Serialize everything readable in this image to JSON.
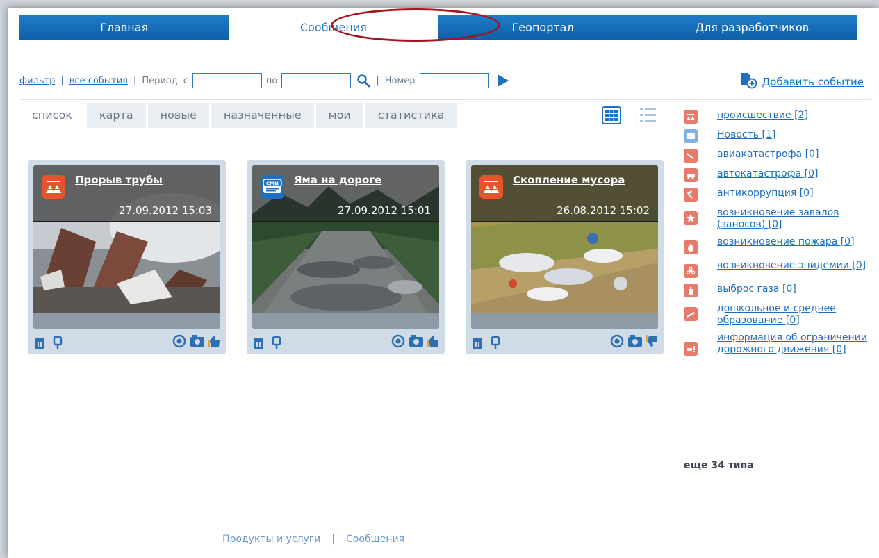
{
  "nav": {
    "items": [
      "Главная",
      "Сообщения",
      "Геопортал",
      "Для разработчиков"
    ],
    "active": 1
  },
  "filter": {
    "filter_link": "фильтр",
    "all_events_link": "все события",
    "period_label": "Период",
    "from_label": "с",
    "to_label": "по",
    "number_label": "Номер",
    "from_value": "",
    "to_value": "",
    "number_value": ""
  },
  "add_event": {
    "label": "Добавить событие"
  },
  "tabs": [
    "список",
    "карта",
    "новые",
    "назначенные",
    "мои",
    "статистика"
  ],
  "active_tab": 0,
  "cards": [
    {
      "title": "Прорыв трубы",
      "date": "27.09.2012 15:03",
      "badge_color": "#e5552b",
      "badge_icon": "incident-icon",
      "scene": "pipe"
    },
    {
      "title": "Яма на дороге",
      "date": "27.09.2012 15:01",
      "badge_color": "#1f6fc0",
      "badge_icon": "news-icon",
      "badge_text": "СМИ",
      "scene": "road"
    },
    {
      "title": "Скопление мусора",
      "date": "26.08.2012 15:02",
      "badge_color": "#e5552b",
      "badge_icon": "incident-icon",
      "scene": "trash"
    }
  ],
  "categories": [
    {
      "label": "происшествие [2]",
      "color": "#e87a6a"
    },
    {
      "label": "Новость [1]",
      "color": "#7fb2e0"
    },
    {
      "label": "авиакатастрофа [0]",
      "color": "#e87a6a"
    },
    {
      "label": "автокатастрофа [0]",
      "color": "#e87a6a"
    },
    {
      "label": "антикоррупция [0]",
      "color": "#e87a6a"
    },
    {
      "label": "возникновение завалов (заносов) [0]",
      "color": "#e87a6a"
    },
    {
      "label": "возникновение пожара [0]",
      "color": "#e87a6a"
    },
    {
      "label": "возникновение эпидемии [0]",
      "color": "#e87a6a"
    },
    {
      "label": "выброс газа [0]",
      "color": "#e87a6a"
    },
    {
      "label": "дошкольное и среднее образование [0]",
      "color": "#e87a6a"
    },
    {
      "label": "информация об ограничении дорожного движения [0]",
      "color": "#e87a6a"
    }
  ],
  "more_types": "еще 34 типа",
  "footer": {
    "products": "Продукты и услуги",
    "messages": "Сообщения"
  }
}
